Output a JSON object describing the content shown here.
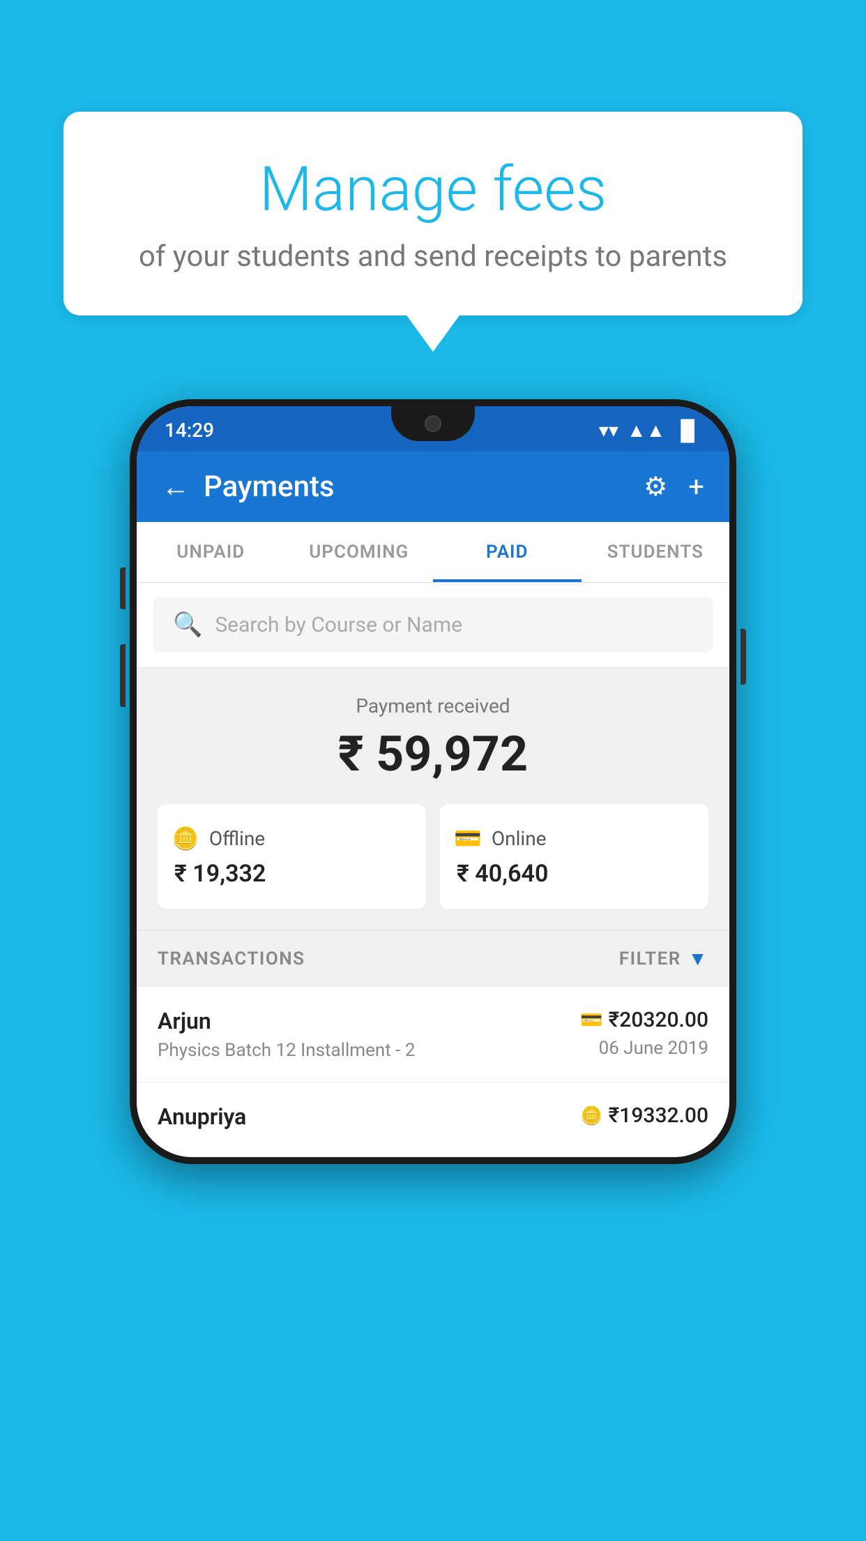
{
  "bubble": {
    "title": "Manage fees",
    "subtitle": "of your students and send receipts to parents"
  },
  "statusBar": {
    "time": "14:29",
    "wifi": "▼",
    "signal": "▲",
    "battery": "▐"
  },
  "appBar": {
    "title": "Payments",
    "back_label": "←",
    "settings_label": "⚙",
    "add_label": "+"
  },
  "tabs": [
    {
      "label": "UNPAID",
      "active": false
    },
    {
      "label": "UPCOMING",
      "active": false
    },
    {
      "label": "PAID",
      "active": true
    },
    {
      "label": "STUDENTS",
      "active": false
    }
  ],
  "search": {
    "placeholder": "Search by Course or Name"
  },
  "paymentSummary": {
    "label": "Payment received",
    "total": "₹ 59,972",
    "offline": {
      "label": "Offline",
      "amount": "₹ 19,332"
    },
    "online": {
      "label": "Online",
      "amount": "₹ 40,640"
    }
  },
  "transactions": {
    "header": "TRANSACTIONS",
    "filter": "FILTER",
    "rows": [
      {
        "name": "Arjun",
        "detail": "Physics Batch 12 Installment - 2",
        "amount": "₹20320.00",
        "date": "06 June 2019",
        "icon_type": "card"
      },
      {
        "name": "Anupriya",
        "detail": "",
        "amount": "₹19332.00",
        "date": "",
        "icon_type": "cash"
      }
    ]
  }
}
